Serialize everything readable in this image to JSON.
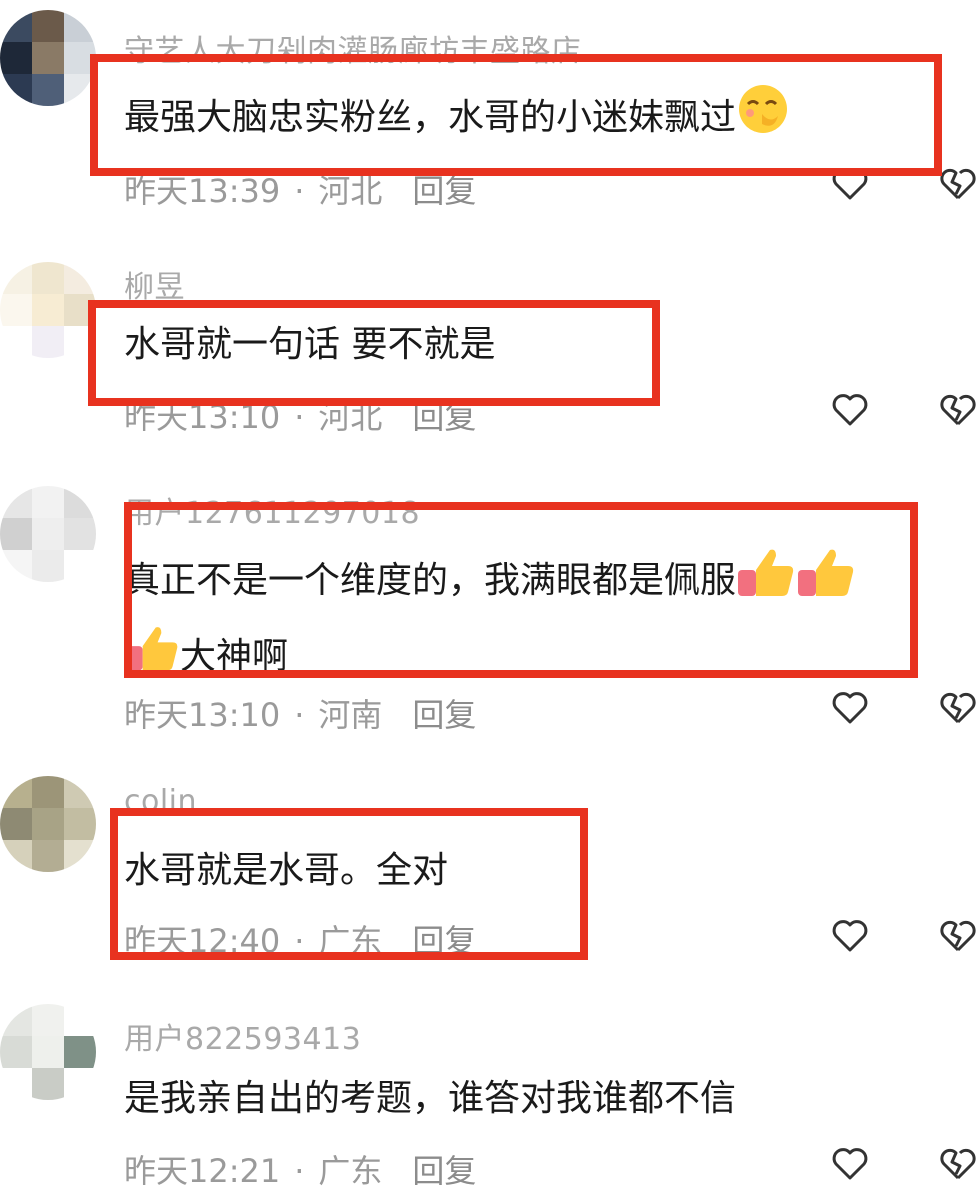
{
  "colors": {
    "highlight": "#e8321f",
    "meta_text": "#9a9a9a",
    "body_text": "#1a1a1a"
  },
  "comments": [
    {
      "username": "守艺人大刀剁肉灌肠廊坊丰盛路店",
      "text": "最强大脑忠实粉丝，水哥的小迷妹飘过",
      "emoji": "shy-face-emoji",
      "time": "昨天13:39",
      "location": "河北",
      "reply_label": "回复"
    },
    {
      "username": "柳昱",
      "text": "水哥就一句话 要不就是",
      "time": "昨天13:10",
      "location": "河北",
      "reply_label": "回复"
    },
    {
      "username": "用户127611297018",
      "text_line1": "真正不是一个维度的，我满眼都是佩服",
      "text_line2": "大神啊",
      "emoji": "thumbs-up-emoji",
      "time": "昨天13:10",
      "location": "河南",
      "reply_label": "回复"
    },
    {
      "username": "colin",
      "text": "水哥就是水哥。全对",
      "time": "昨天12:40",
      "location": "广东",
      "reply_label": "回复"
    },
    {
      "username": "用户822593413",
      "text": "是我亲自出的考题，谁答对我谁都不信",
      "time": "昨天12:21",
      "location": "广东",
      "reply_label": "回复"
    }
  ]
}
